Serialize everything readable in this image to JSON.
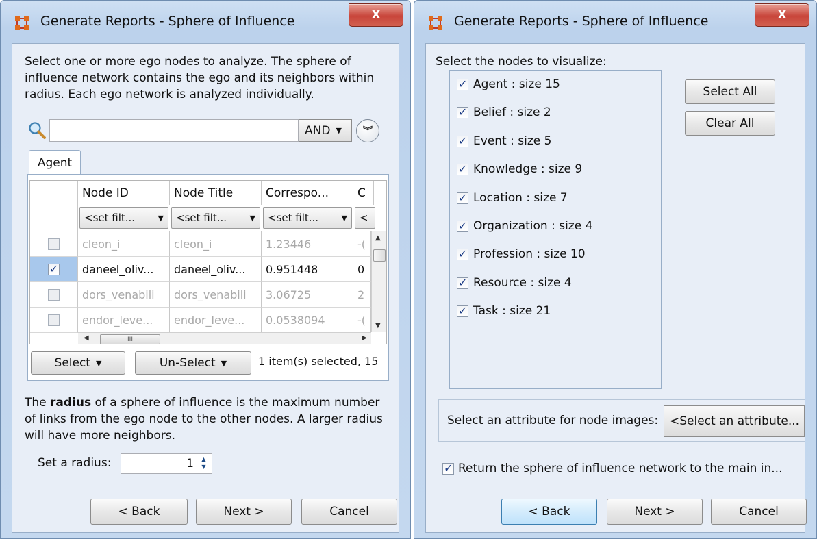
{
  "colors": {
    "window_frame": "#bcd2ec",
    "client_bg": "#e8eef7",
    "close_button": "#c8453a",
    "selection": "#a8c8ec"
  },
  "left_dialog": {
    "title": "Generate Reports - Sphere of Influence",
    "close_label": "X",
    "intro": "Select one or more ego nodes to analyze. The sphere of influence network contains the ego and its neighbors within radius. Each ego network is analyzed individually.",
    "search": {
      "value": "",
      "operator": "AND"
    },
    "tab_label": "Agent",
    "table": {
      "columns": [
        "Node ID",
        "Node Title",
        "Correspo...",
        "C"
      ],
      "filter_label": "<set filt...",
      "filter_partial": "<",
      "rows": [
        {
          "checked": false,
          "selected": false,
          "cells": [
            "cleon_i",
            "cleon_i",
            "1.23446",
            "-("
          ]
        },
        {
          "checked": true,
          "selected": true,
          "cells": [
            "daneel_oliv...",
            "daneel_oliv...",
            "0.951448",
            "0"
          ]
        },
        {
          "checked": false,
          "selected": false,
          "cells": [
            "dors_venabili",
            "dors_venabili",
            "3.06725",
            "2"
          ]
        },
        {
          "checked": false,
          "selected": false,
          "cells": [
            "endor_leve...",
            "endor_leve...",
            "0.0538094",
            "-("
          ]
        }
      ],
      "hscroll_grip": "III"
    },
    "select_label": "Select",
    "unselect_label": "Un-Select",
    "selection_status": "1 item(s) selected, 15",
    "radius_text": {
      "bold": "radius",
      "before": "The ",
      "after": " of a sphere of influence is the maximum number of links from the ego node to the other nodes. A larger radius will have more neighbors."
    },
    "radius_label": "Set a radius:",
    "radius_value": "1",
    "back_label": "< Back",
    "next_label": "Next >",
    "cancel_label": "Cancel"
  },
  "right_dialog": {
    "title": "Generate Reports - Sphere of Influence",
    "close_label": "X",
    "prompt": "Select the nodes to visualize:",
    "nodes": [
      {
        "label": "Agent : size 15",
        "checked": true
      },
      {
        "label": "Belief : size 2",
        "checked": true
      },
      {
        "label": "Event : size 5",
        "checked": true
      },
      {
        "label": "Knowledge : size 9",
        "checked": true
      },
      {
        "label": "Location : size 7",
        "checked": true
      },
      {
        "label": "Organization : size 4",
        "checked": true
      },
      {
        "label": "Profession : size 10",
        "checked": true
      },
      {
        "label": "Resource : size 4",
        "checked": true
      },
      {
        "label": "Task : size 21",
        "checked": true
      }
    ],
    "select_all_label": "Select All",
    "clear_all_label": "Clear All",
    "attribute_label": "Select an attribute for node images:",
    "attribute_value": "<Select an attribute...",
    "return_label": "Return the sphere of influence network to the main in...",
    "return_checked": true,
    "back_label": "< Back",
    "next_label": "Next >",
    "cancel_label": "Cancel"
  }
}
